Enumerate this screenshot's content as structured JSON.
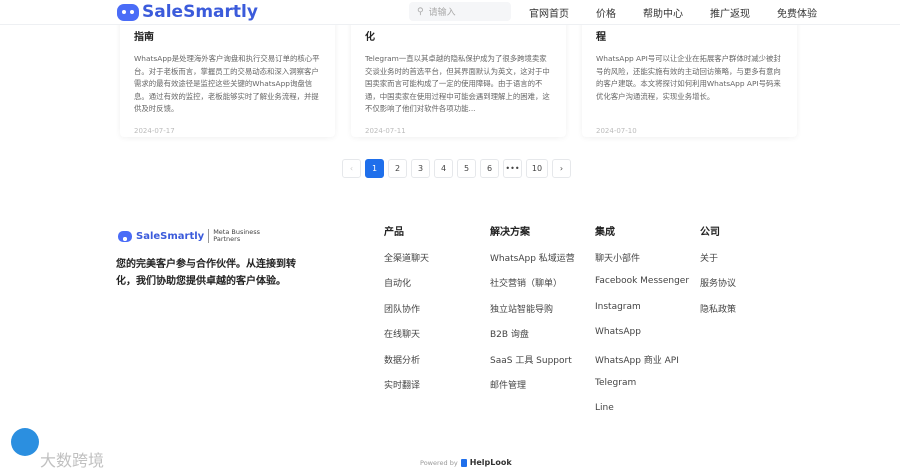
{
  "header": {
    "logo": "SaleSmartly",
    "search_placeholder": "请输入",
    "nav": [
      "官网首页",
      "价格",
      "帮助中心",
      "推广返现",
      "免费体验"
    ]
  },
  "cards": [
    {
      "title": "指南",
      "text": "WhatsApp是处理海外客户询盘和执行交易订单的核心平台。对于老板而言，掌握员工的交易动态和深入洞察客户需求的最有效途径是监控这些关键的WhatsApp询盘信息。通过有效的监控，老板能够实时了解业务流程，并提供及时反馈。",
      "date": "2024-07-17"
    },
    {
      "title": "化",
      "text": "Telegram一直以其卓越的隐私保护成为了很多跨境卖家交谈业务时的首选平台，但其界面默认为英文，这对于中国卖家而言可能构成了一定的使用障碍。由于语言的不通，中国卖家在使用过程中可能会遇到理解上的困难，这不仅影响了他们对软件各项功能...",
      "date": "2024-07-11"
    },
    {
      "title": "程",
      "text": "WhatsApp API号可以让企业在拓展客户群体时减少被封号的风险，还能实施有效的主动回访策略，与更多有意向的客户建联。本文将探讨如何利用WhatsApp API号码来优化客户沟通流程，实现业务增长。",
      "date": "2024-07-10"
    }
  ],
  "pagination": {
    "prev": "‹",
    "pages": [
      "1",
      "2",
      "3",
      "4",
      "5",
      "6",
      "•••",
      "10"
    ],
    "current": "1",
    "next": "›"
  },
  "footer": {
    "logo": "SaleSmartly",
    "partner": "Meta Business Partners",
    "tagline": "您的完美客户参与合作伙伴。从连接到转化，我们协助您提供卓越的客户体验。",
    "columns": [
      {
        "title": "产品",
        "items": [
          "全渠道聊天",
          "自动化",
          "团队协作",
          "在线聊天",
          "数据分析",
          "实时翻译"
        ]
      },
      {
        "title": "解决方案",
        "items": [
          "WhatsApp 私域运营",
          "社交营销（聊单）",
          "独立站智能导购",
          "B2B 询盘",
          "SaaS 工具 Support",
          "邮件管理"
        ]
      },
      {
        "title": "集成",
        "items": [
          "聊天小部件",
          "Facebook Messenger",
          "Instagram",
          "WhatsApp",
          "WhatsApp 商业 API",
          "Telegram",
          "Line"
        ]
      },
      {
        "title": "公司",
        "items": [
          "关于",
          "服务协议",
          "隐私政策"
        ]
      }
    ],
    "powered_by": "Powered by",
    "powered_brand": "HelpLook"
  },
  "watermark": "大数跨境"
}
